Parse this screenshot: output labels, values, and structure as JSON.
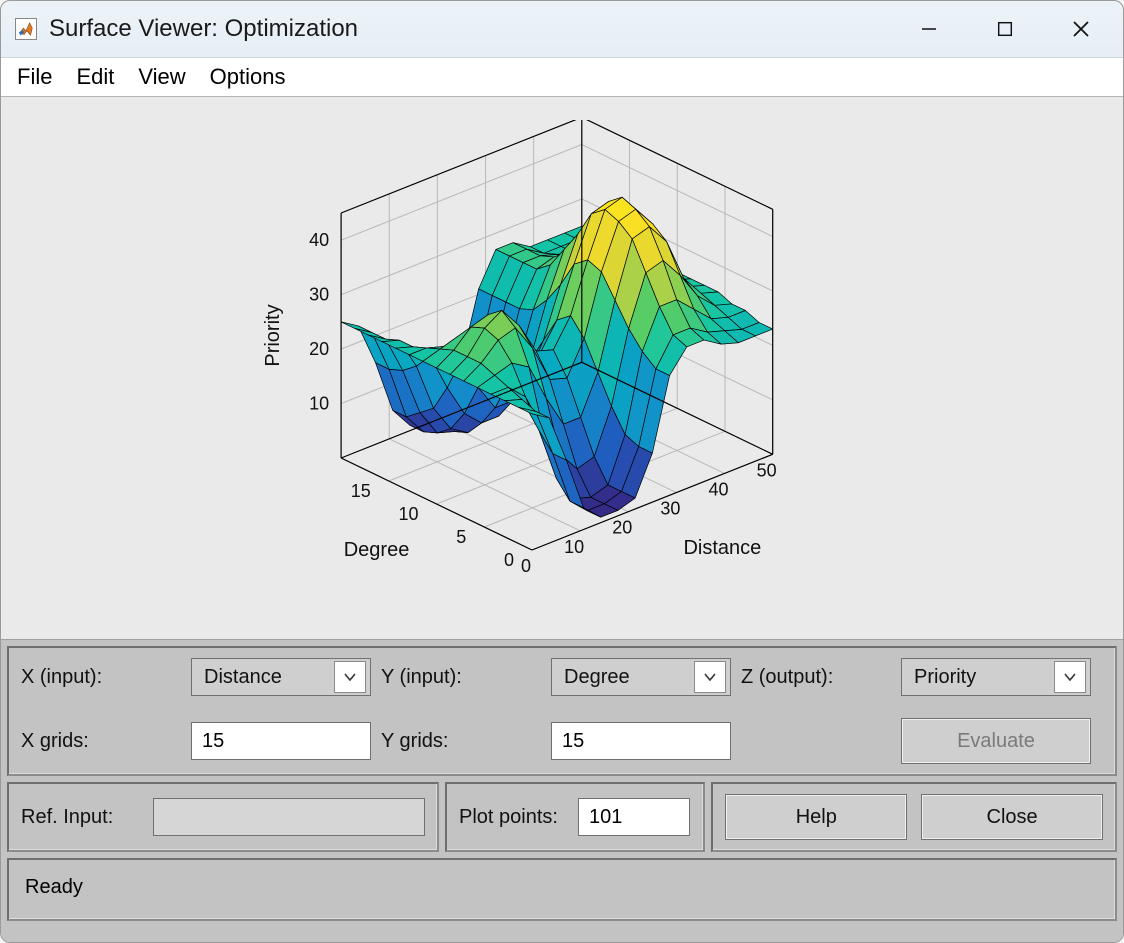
{
  "window": {
    "title": "Surface Viewer: Optimization"
  },
  "menu": {
    "file": "File",
    "edit": "Edit",
    "view": "View",
    "options": "Options"
  },
  "controls": {
    "x_input_label": "X (input):",
    "y_input_label": "Y (input):",
    "z_output_label": "Z (output):",
    "x_input_value": "Distance",
    "y_input_value": "Degree",
    "z_output_value": "Priority",
    "x_grids_label": "X grids:",
    "y_grids_label": "Y grids:",
    "x_grids_value": "15",
    "y_grids_value": "15",
    "evaluate_label": "Evaluate",
    "ref_input_label": "Ref. Input:",
    "ref_input_value": "",
    "plot_points_label": "Plot points:",
    "plot_points_value": "101",
    "help_label": "Help",
    "close_label": "Close"
  },
  "status": {
    "text": "Ready"
  },
  "chart_data": {
    "type": "surface",
    "xlabel": "Distance",
    "ylabel": "Degree",
    "zlabel": "Priority",
    "x_ticks": [
      0,
      10,
      20,
      30,
      40,
      50
    ],
    "y_ticks": [
      0,
      5,
      10,
      15
    ],
    "z_ticks": [
      10,
      20,
      30,
      40
    ],
    "x_range": [
      0,
      50
    ],
    "y_range": [
      0,
      20
    ],
    "z_range": [
      0,
      45
    ],
    "x": [
      0.0,
      3.571,
      7.143,
      10.714,
      14.286,
      17.857,
      21.429,
      25.0,
      28.571,
      32.143,
      35.714,
      39.286,
      42.857,
      46.429,
      50.0
    ],
    "y": [
      0.0,
      1.429,
      2.857,
      4.286,
      5.714,
      7.143,
      8.571,
      10.0,
      11.429,
      12.857,
      14.286,
      15.714,
      17.143,
      18.571,
      20.0
    ],
    "z": [
      [
        25,
        23,
        14,
        4,
        1,
        1,
        2,
        9,
        22,
        26,
        26,
        24,
        23,
        23,
        23
      ],
      [
        25,
        23,
        14,
        4,
        1,
        1,
        2,
        9,
        22,
        27,
        27,
        25,
        24,
        23,
        23
      ],
      [
        25,
        24,
        17,
        7,
        2,
        1,
        2,
        10,
        24,
        31,
        31,
        28,
        25,
        24,
        24
      ],
      [
        25,
        25,
        22,
        15,
        9,
        5,
        6,
        14,
        27,
        36,
        37,
        33,
        28,
        25,
        24
      ],
      [
        25,
        26,
        27,
        25,
        18,
        12,
        12,
        19,
        31,
        41,
        42,
        38,
        30,
        26,
        25
      ],
      [
        25,
        27,
        30,
        31,
        26,
        19,
        18,
        24,
        35,
        43,
        44,
        40,
        31,
        26,
        25
      ],
      [
        25,
        27,
        31,
        33,
        29,
        23,
        22,
        27,
        36,
        44,
        45,
        41,
        31,
        26,
        25
      ],
      [
        25,
        27,
        30,
        31,
        27,
        21,
        20,
        25,
        34,
        42,
        43,
        39,
        30,
        26,
        25
      ],
      [
        25,
        26,
        27,
        26,
        21,
        15,
        14,
        20,
        29,
        37,
        38,
        35,
        29,
        26,
        25
      ],
      [
        25,
        25,
        24,
        20,
        14,
        9,
        9,
        15,
        25,
        33,
        34,
        31,
        27,
        25,
        25
      ],
      [
        25,
        24,
        21,
        14,
        8,
        5,
        5,
        12,
        22,
        29,
        30,
        28,
        26,
        25,
        25
      ],
      [
        25,
        24,
        18,
        9,
        4,
        2,
        3,
        10,
        21,
        27,
        28,
        26,
        25,
        25,
        25
      ],
      [
        25,
        23,
        16,
        7,
        2,
        1,
        2,
        9,
        21,
        27,
        27,
        26,
        25,
        25,
        25
      ],
      [
        25,
        23,
        15,
        5,
        1,
        1,
        2,
        9,
        21,
        27,
        27,
        25,
        25,
        25,
        25
      ],
      [
        25,
        23,
        15,
        5,
        1,
        1,
        2,
        9,
        21,
        27,
        27,
        25,
        25,
        25,
        25
      ]
    ],
    "colormap": "parula",
    "note": "z[j][i] gives Priority at Distance=x[i], Degree=y[j]; values estimated from gridlines and colors"
  }
}
